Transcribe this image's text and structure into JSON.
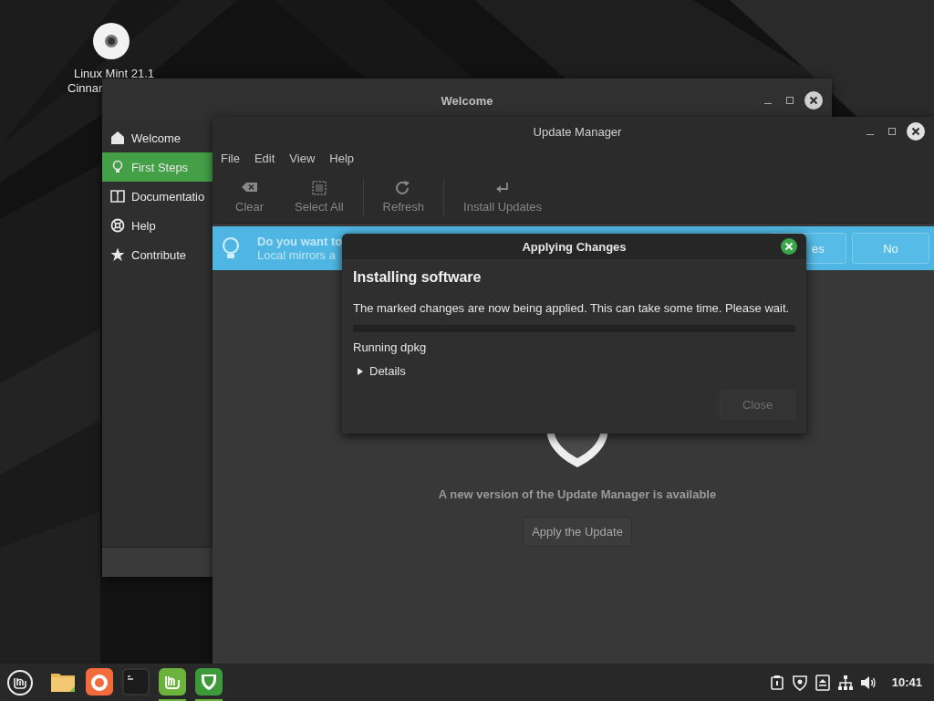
{
  "desktop": {
    "icon_label": [
      "Linux Mint 21.1",
      "Cinnar"
    ]
  },
  "welcome_window": {
    "title": "Welcome",
    "sidebar": {
      "items": [
        {
          "label": "Welcome",
          "selected": false
        },
        {
          "label": "First Steps",
          "selected": true
        },
        {
          "label": "Documentatio",
          "selected": false
        },
        {
          "label": "Help",
          "selected": false
        },
        {
          "label": "Contribute",
          "selected": false
        }
      ]
    }
  },
  "update_manager": {
    "title": "Update Manager",
    "menu": [
      "File",
      "Edit",
      "View",
      "Help"
    ],
    "toolbar": [
      {
        "label": "Clear",
        "disabled": true
      },
      {
        "label": "Select All",
        "disabled": true
      },
      {
        "label": "Refresh",
        "disabled": true
      },
      {
        "label": "Install Updates",
        "disabled": true
      }
    ],
    "banner": {
      "title": "Do you want to",
      "text": "Local mirrors a",
      "buttons": [
        "es",
        "No"
      ]
    },
    "message": "A new version of the Update Manager is available",
    "button": "Apply the Update"
  },
  "dialog": {
    "title": "Applying Changes",
    "heading": "Installing software",
    "text": "The marked changes are now being applied. This can take some time. Please wait.",
    "progress": {
      "level": 0
    },
    "status": "Running dpkg",
    "expander": {
      "label": "Details",
      "expanded": false
    },
    "buttons": [
      {
        "label": "Close",
        "disabled": true
      }
    ]
  },
  "taskbar": {
    "launchers": [
      {
        "running": false
      },
      {
        "running": false
      },
      {
        "running": false
      },
      {
        "running": true
      },
      {
        "running": true
      }
    ],
    "clock": "10:41"
  }
}
